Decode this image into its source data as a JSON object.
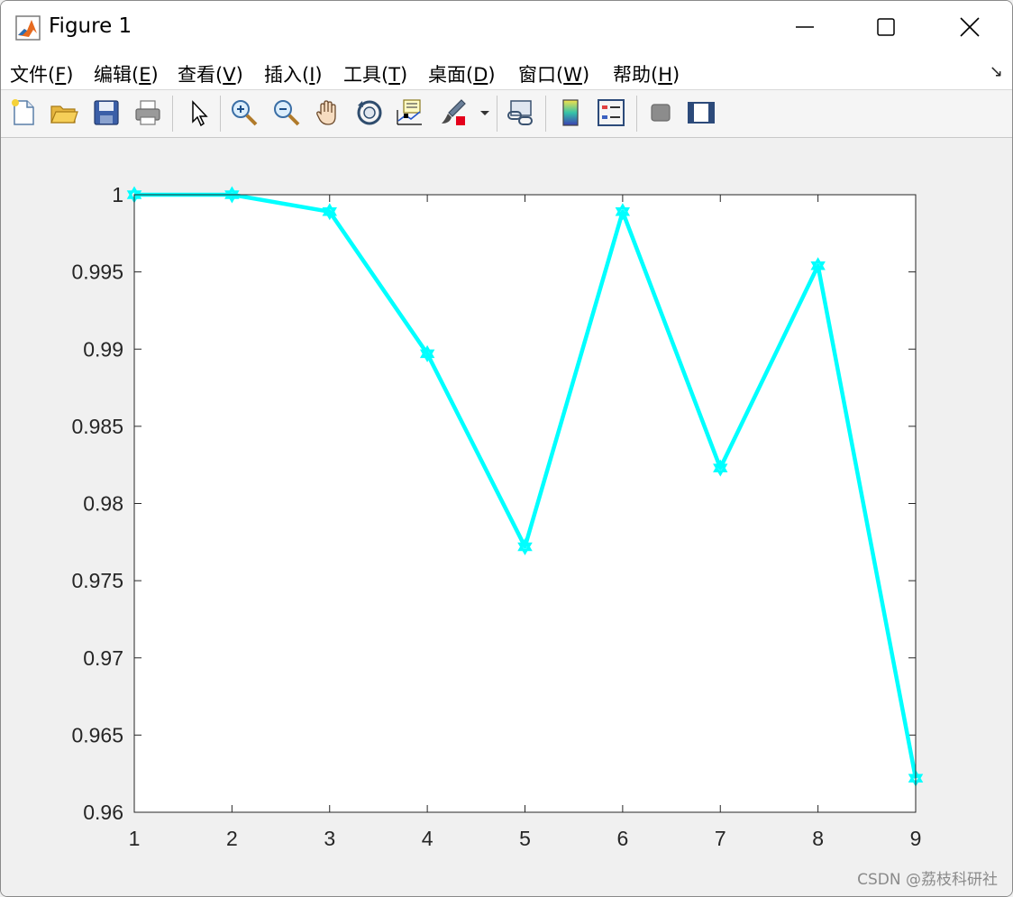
{
  "window": {
    "title": "Figure 1",
    "controls": {
      "minimize": "minimize",
      "maximize": "maximize",
      "close": "close"
    }
  },
  "menu": {
    "items": [
      {
        "label": "文件(",
        "key": "F",
        "tail": ")"
      },
      {
        "label": "编辑(",
        "key": "E",
        "tail": ")"
      },
      {
        "label": "查看(",
        "key": "V",
        "tail": ")"
      },
      {
        "label": "插入(",
        "key": "I",
        "tail": ")"
      },
      {
        "label": "工具(",
        "key": "T",
        "tail": ")"
      },
      {
        "label": "桌面(",
        "key": "D",
        "tail": ")"
      },
      {
        "label": "窗口(",
        "key": "W",
        "tail": ")"
      },
      {
        "label": "帮助(",
        "key": "H",
        "tail": ")"
      }
    ]
  },
  "toolbar": {
    "icons": [
      "new-figure-icon",
      "open-file-icon",
      "save-icon",
      "print-icon",
      "edit-plot-arrow-icon",
      "zoom-in-icon",
      "zoom-out-icon",
      "pan-hand-icon",
      "rotate-3d-icon",
      "data-cursor-icon",
      "brush-icon",
      "brush-dropdown-icon",
      "link-plot-icon",
      "colorbar-icon",
      "legend-icon",
      "hide-plot-tools-icon",
      "show-plot-tools-icon"
    ]
  },
  "chart_data": {
    "type": "line",
    "x": [
      1,
      2,
      3,
      4,
      5,
      6,
      7,
      8,
      9
    ],
    "series": [
      {
        "values": [
          1.0,
          1.0,
          0.9989,
          0.9897,
          0.9772,
          0.9989,
          0.9823,
          0.9954,
          0.9622
        ]
      }
    ],
    "xlim": [
      1,
      9
    ],
    "ylim": [
      0.96,
      1.0
    ],
    "xticks": [
      "1",
      "2",
      "3",
      "4",
      "5",
      "6",
      "7",
      "8",
      "9"
    ],
    "yticks": [
      "0.96",
      "0.965",
      "0.97",
      "0.975",
      "0.98",
      "0.985",
      "0.99",
      "0.995",
      "1"
    ],
    "grid": false,
    "line_color": "#00ffff",
    "marker": "hexagram"
  },
  "watermark": "CSDN @荔枝科研社"
}
